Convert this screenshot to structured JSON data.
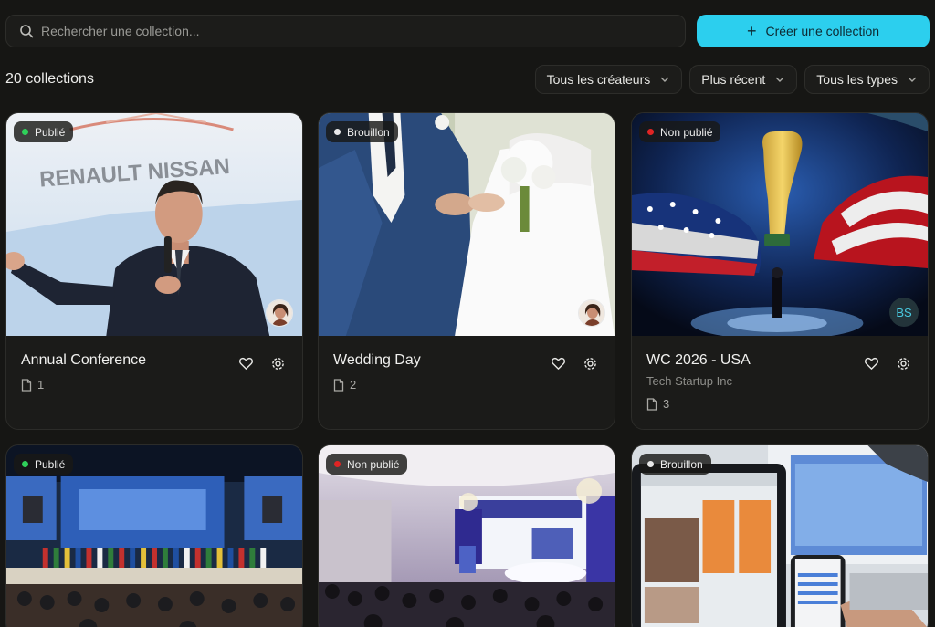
{
  "search": {
    "placeholder": "Rechercher une collection..."
  },
  "create_button": {
    "label": "Créer une collection"
  },
  "count_label": "20 collections",
  "filters": [
    {
      "label": "Tous les créateurs"
    },
    {
      "label": "Plus récent"
    },
    {
      "label": "Tous les types"
    }
  ],
  "colors": {
    "accent": "#2ccfee",
    "published": "#2fd05a",
    "draft": "#e8e8e8",
    "unpublished": "#e02424"
  },
  "cards": [
    {
      "status": "Publié",
      "status_color": "#2fd05a",
      "title": "Annual Conference",
      "subtitle": "",
      "files": "1",
      "owner": "avatar"
    },
    {
      "status": "Brouillon",
      "status_color": "#e8e8e8",
      "title": "Wedding Day",
      "subtitle": "",
      "files": "2",
      "owner": "avatar"
    },
    {
      "status": "Non publié",
      "status_color": "#e02424",
      "title": "WC 2026 - USA",
      "subtitle": "Tech Startup Inc",
      "files": "3",
      "owner": "BS"
    },
    {
      "status": "Publié",
      "status_color": "#2fd05a"
    },
    {
      "status": "Non publié",
      "status_color": "#e02424"
    },
    {
      "status": "Brouillon",
      "status_color": "#e8e8e8"
    }
  ],
  "thumb_text": {
    "sign": "RENAULT NISSAN"
  }
}
